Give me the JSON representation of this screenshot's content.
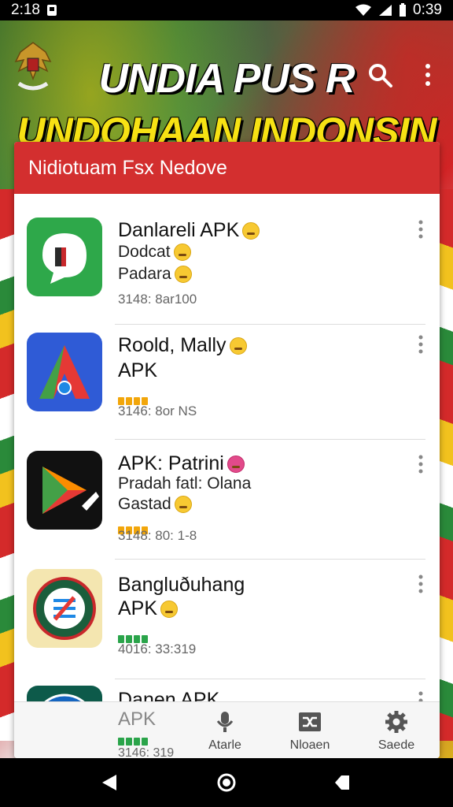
{
  "status_bar": {
    "time_left": "2:18",
    "time_right": "0:39"
  },
  "header": {
    "title_line1": "UNDIA PUS R",
    "title_line2": "UNDOHAAN INDONSIN",
    "search_icon": "search-icon",
    "more_icon": "more-vertical-icon"
  },
  "card": {
    "title": "Nidiotuam Fsx Nedove"
  },
  "apps": [
    {
      "name": "Danlareli APK",
      "line2": "Dodcat",
      "line3": "Padara",
      "meta": "3148: 8ar100",
      "icon": "green-chat-app-icon"
    },
    {
      "name": "Roold, Mally",
      "line2": "APK",
      "line3": "",
      "meta": "3146: 8or NS",
      "icon": "blue-a-app-icon"
    },
    {
      "name": "APK: Patrini",
      "line2": "Pradah fatl: Olana",
      "line3": "Gastad",
      "meta": "3148: 80: 1-8",
      "icon": "play-triangle-app-icon"
    },
    {
      "name": "Bangluðuhang",
      "line2": "APK",
      "line3": "",
      "meta": "4016: 33:319",
      "icon": "badge-app-icon"
    },
    {
      "name": "Danen APK",
      "line2": "",
      "line3": "",
      "meta": "",
      "icon": "globe-app-icon"
    }
  ],
  "bottom_nav": {
    "apk_label": "APK",
    "apk_meta": "3146: 319",
    "items": [
      {
        "label": "Atarle",
        "icon": "microphone-icon"
      },
      {
        "label": "Nloaen",
        "icon": "shuffle-icon"
      },
      {
        "label": "Saede",
        "icon": "settings-gear-icon"
      }
    ]
  },
  "colors": {
    "header_red": "#d32f2f",
    "title_yellow": "#f7e214",
    "accent_green": "#2aa44a"
  }
}
